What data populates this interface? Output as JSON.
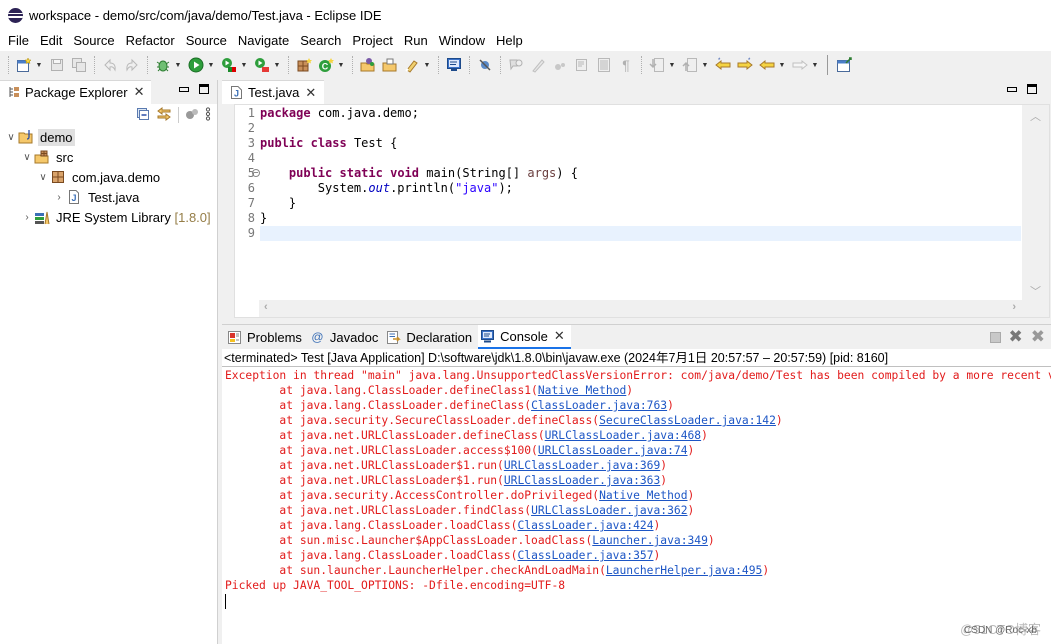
{
  "window": {
    "title": "workspace - demo/src/com/java/demo/Test.java - Eclipse IDE"
  },
  "menu": [
    "File",
    "Edit",
    "Source",
    "Refactor",
    "Source",
    "Navigate",
    "Search",
    "Project",
    "Run",
    "Window",
    "Help"
  ],
  "toolbar": {
    "icons": [
      "new-icon",
      "save-icon",
      "save-all-icon",
      "undo-icon",
      "redo-icon",
      "debug-icon",
      "run-icon",
      "coverage-icon",
      "external-tools-icon",
      "new-java-package-icon",
      "new-java-class-icon",
      "open-type-icon",
      "open-task-icon",
      "search-icon",
      "console-icon",
      "skip-breakpoints-icon",
      "toggle-mark-occurrences-icon",
      "toggle-editor-icon",
      "show-whitespace-icon",
      "next-annotation-icon",
      "previous-annotation-icon",
      "last-edit-icon",
      "back-icon",
      "forward-icon",
      "open-perspective-icon"
    ]
  },
  "package_explorer": {
    "title": "Package Explorer",
    "tree": [
      {
        "label": "demo",
        "depth": 0,
        "expanded": true,
        "icon": "project-icon",
        "selected": true
      },
      {
        "label": "src",
        "depth": 1,
        "expanded": true,
        "icon": "source-folder-icon"
      },
      {
        "label": "com.java.demo",
        "depth": 2,
        "expanded": true,
        "icon": "package-icon"
      },
      {
        "label": "Test.java",
        "depth": 3,
        "expanded": false,
        "icon": "java-file-icon"
      },
      {
        "label": "JRE System Library",
        "decoration": "[1.8.0]",
        "depth": 1,
        "expanded": false,
        "icon": "library-icon"
      }
    ]
  },
  "editor": {
    "tab_label": "Test.java",
    "lines": [
      {
        "n": "1",
        "tokens": [
          [
            "kw",
            "package"
          ],
          [
            "",
            "com.java.demo;"
          ]
        ]
      },
      {
        "n": "2",
        "tokens": []
      },
      {
        "n": "3",
        "tokens": [
          [
            "kw",
            "public"
          ],
          [
            "",
            " "
          ],
          [
            "kw",
            "class"
          ],
          [
            "",
            " Test {"
          ]
        ]
      },
      {
        "n": "4",
        "tokens": []
      },
      {
        "n": "5",
        "fold": true,
        "tokens": [
          [
            "",
            "    "
          ],
          [
            "kw",
            "public"
          ],
          [
            "",
            " "
          ],
          [
            "kw",
            "static"
          ],
          [
            "",
            " "
          ],
          [
            "kw",
            "void"
          ],
          [
            "",
            " main(String[] "
          ],
          [
            "param",
            "args"
          ],
          [
            "",
            ") {"
          ]
        ]
      },
      {
        "n": "6",
        "tokens": [
          [
            "",
            "        System."
          ],
          [
            "fld",
            "out"
          ],
          [
            "",
            ".println("
          ],
          [
            "str",
            "\"java\""
          ],
          [
            "",
            ");"
          ]
        ]
      },
      {
        "n": "7",
        "tokens": [
          [
            "",
            "    }"
          ]
        ]
      },
      {
        "n": "8",
        "tokens": [
          [
            "",
            "}"
          ]
        ]
      },
      {
        "n": "9",
        "current": true,
        "tokens": []
      }
    ]
  },
  "console": {
    "tabs": [
      {
        "label": "Problems",
        "icon": "problems-icon"
      },
      {
        "label": "Javadoc",
        "icon": "javadoc-icon"
      },
      {
        "label": "Declaration",
        "icon": "declaration-icon"
      },
      {
        "label": "Console",
        "icon": "console-icon",
        "active": true
      }
    ],
    "status": "<terminated> Test [Java Application] D:\\software\\jdk\\1.8.0\\bin\\javaw.exe  (2024年7月1日 20:57:57 – 20:57:59) [pid: 8160]",
    "output": [
      {
        "text": "Exception in thread \"main\" java.lang.UnsupportedClassVersionError: com/java/demo/Test has been compiled by a more recent version of the Java Runtime"
      },
      {
        "text": "\tat java.lang.ClassLoader.defineClass1(",
        "link": "Native Method",
        "after": ")"
      },
      {
        "text": "\tat java.lang.ClassLoader.defineClass(",
        "link": "ClassLoader.java:763",
        "after": ")"
      },
      {
        "text": "\tat java.security.SecureClassLoader.defineClass(",
        "link": "SecureClassLoader.java:142",
        "after": ")"
      },
      {
        "text": "\tat java.net.URLClassLoader.defineClass(",
        "link": "URLClassLoader.java:468",
        "after": ")"
      },
      {
        "text": "\tat java.net.URLClassLoader.access$100(",
        "link": "URLClassLoader.java:74",
        "after": ")"
      },
      {
        "text": "\tat java.net.URLClassLoader$1.run(",
        "link": "URLClassLoader.java:369",
        "after": ")"
      },
      {
        "text": "\tat java.net.URLClassLoader$1.run(",
        "link": "URLClassLoader.java:363",
        "after": ")"
      },
      {
        "text": "\tat java.security.AccessController.doPrivileged(",
        "link": "Native Method",
        "after": ")"
      },
      {
        "text": "\tat java.net.URLClassLoader.findClass(",
        "link": "URLClassLoader.java:362",
        "after": ")"
      },
      {
        "text": "\tat java.lang.ClassLoader.loadClass(",
        "link": "ClassLoader.java:424",
        "after": ")"
      },
      {
        "text": "\tat sun.misc.Launcher$AppClassLoader.loadClass(",
        "link": "Launcher.java:349",
        "after": ")"
      },
      {
        "text": "\tat java.lang.ClassLoader.loadClass(",
        "link": "ClassLoader.java:357",
        "after": ")"
      },
      {
        "text": "\tat sun.launcher.LauncherHelper.checkAndLoadMain(",
        "link": "LauncherHelper.java:495",
        "after": ")"
      },
      {
        "text": "Picked up JAVA_TOOL_OPTIONS: -Dfile.encoding=UTF-8"
      }
    ]
  },
  "watermark": {
    "text": "@51CTO博客",
    "sub": "CSDN @Roc-xb"
  }
}
